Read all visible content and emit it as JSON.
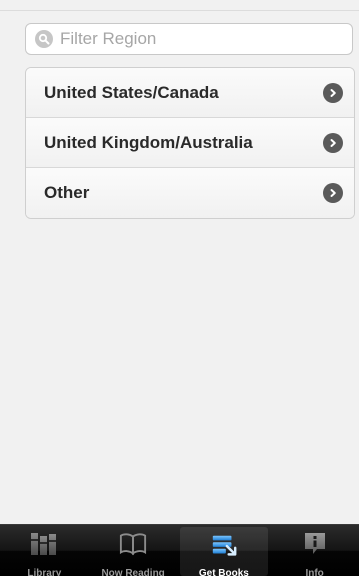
{
  "search": {
    "placeholder": "Filter Region",
    "value": ""
  },
  "regions": {
    "items": [
      {
        "label": "United States/Canada",
        "icon": "chevron-right-icon"
      },
      {
        "label": "United Kingdom/Australia",
        "icon": "chevron-right-icon"
      },
      {
        "label": "Other",
        "icon": "chevron-right-icon"
      }
    ]
  },
  "tabbar": {
    "tabs": [
      {
        "label": "Library",
        "icon": "library-icon",
        "active": false
      },
      {
        "label": "Now Reading",
        "icon": "open-book-icon",
        "active": false
      },
      {
        "label": "Get Books",
        "icon": "get-books-icon",
        "active": true
      },
      {
        "label": "Info",
        "icon": "info-icon",
        "active": false
      }
    ]
  },
  "colors": {
    "background": "#f1f1f1",
    "tabbar": "#000000",
    "active_tab_icon": "#3b9bea",
    "chevron": "#5a5a5a"
  }
}
